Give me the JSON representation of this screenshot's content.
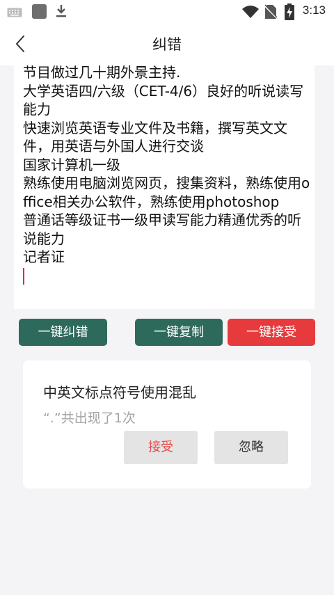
{
  "status_bar": {
    "time": "3:13",
    "icons": [
      "keyboard-icon",
      "app-icon",
      "download-icon",
      "wifi-icon",
      "no-sim-icon",
      "battery-charging-icon"
    ]
  },
  "header": {
    "title": "纠错",
    "back_icon": "chevron-left-icon"
  },
  "editor": {
    "lines": [
      "节目做过几十期外景主持.",
      "大学英语四/六级（CET-4/6）良好的听说读写能力",
      "快速浏览英语专业文件及书籍，撰写英文文件，用英语与外国人进行交谈",
      "国家计算机一级",
      "熟练使用电脑浏览网页，搜集资料，熟练使用office相关办公软件，熟练使用photoshop",
      "普通话等级证书一级甲读写能力精通优秀的听说能力",
      "记者证"
    ]
  },
  "actions": {
    "correct": "一键纠错",
    "copy": "一键复制",
    "accept_all": "一键接受"
  },
  "suggestion": {
    "title": "中英文标点符号使用混乱",
    "detail": "“.”共出现了1次",
    "accept": "接受",
    "ignore": "忽略"
  },
  "colors": {
    "primary_green": "#2e6a5c",
    "accent_red": "#e63a3d",
    "caret": "#d6246e"
  }
}
